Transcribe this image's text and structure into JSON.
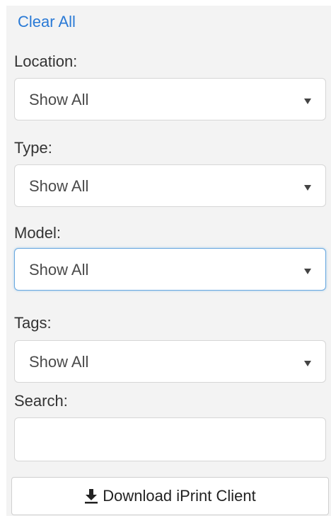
{
  "filters": {
    "clear_all": "Clear All",
    "location": {
      "label": "Location:",
      "value": "Show All"
    },
    "type": {
      "label": "Type:",
      "value": "Show All"
    },
    "model": {
      "label": "Model:",
      "value": "Show All"
    },
    "tags": {
      "label": "Tags:",
      "value": "Show All"
    },
    "search": {
      "label": "Search:",
      "value": ""
    }
  },
  "download": {
    "label": "Download iPrint Client",
    "icon": "download-icon"
  },
  "colors": {
    "link": "#2a7ad6",
    "panel_bg": "#f3f3f3",
    "focus_border": "#6aa8df"
  }
}
